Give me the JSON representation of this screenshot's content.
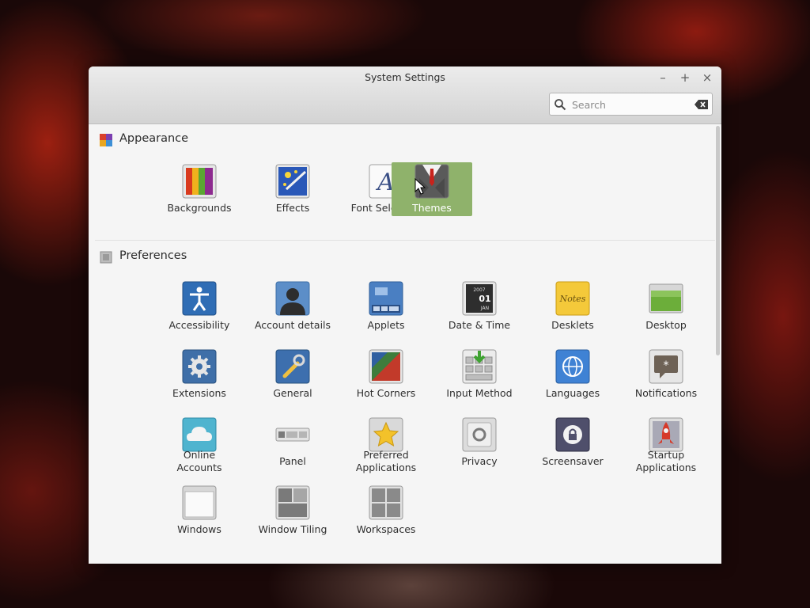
{
  "window": {
    "title": "System Settings",
    "controls": {
      "minimize": "–",
      "maximize": "+",
      "close": "×"
    }
  },
  "search": {
    "placeholder": "Search",
    "value": ""
  },
  "accent": "#8fb26b",
  "sections": [
    {
      "title": "Appearance",
      "icon": "appearance-icon",
      "items": [
        {
          "label": "Backgrounds",
          "icon": "backgrounds-icon"
        },
        {
          "label": "Effects",
          "icon": "effects-icon"
        },
        {
          "label": "Font Selection",
          "icon": "font-selection-icon"
        },
        {
          "label": "Themes",
          "icon": "themes-icon",
          "selected": true
        }
      ]
    },
    {
      "title": "Preferences",
      "icon": "preferences-icon",
      "items": [
        {
          "label": "Accessibility",
          "icon": "accessibility-icon"
        },
        {
          "label": "Account details",
          "icon": "account-details-icon"
        },
        {
          "label": "Applets",
          "icon": "applets-icon"
        },
        {
          "label": "Date & Time",
          "icon": "date-time-icon"
        },
        {
          "label": "Desklets",
          "icon": "desklets-icon"
        },
        {
          "label": "Desktop",
          "icon": "desktop-icon"
        },
        {
          "label": "Extensions",
          "icon": "extensions-icon"
        },
        {
          "label": "General",
          "icon": "general-icon"
        },
        {
          "label": "Hot Corners",
          "icon": "hot-corners-icon"
        },
        {
          "label": "Input Method",
          "icon": "input-method-icon"
        },
        {
          "label": "Languages",
          "icon": "languages-icon"
        },
        {
          "label": "Notifications",
          "icon": "notifications-icon"
        },
        {
          "label": "Online\nAccounts",
          "icon": "online-accounts-icon"
        },
        {
          "label": "Panel",
          "icon": "panel-icon"
        },
        {
          "label": "Preferred\nApplications",
          "icon": "preferred-applications-icon"
        },
        {
          "label": "Privacy",
          "icon": "privacy-icon"
        },
        {
          "label": "Screensaver",
          "icon": "screensaver-icon"
        },
        {
          "label": "Startup\nApplications",
          "icon": "startup-applications-icon"
        },
        {
          "label": "Windows",
          "icon": "windows-icon"
        },
        {
          "label": "Window Tiling",
          "icon": "window-tiling-icon"
        },
        {
          "label": "Workspaces",
          "icon": "workspaces-icon"
        }
      ]
    }
  ],
  "date_icon_text": {
    "year": "2007",
    "month": "JAN",
    "day": "01"
  },
  "desklets_icon_text": "Notes"
}
